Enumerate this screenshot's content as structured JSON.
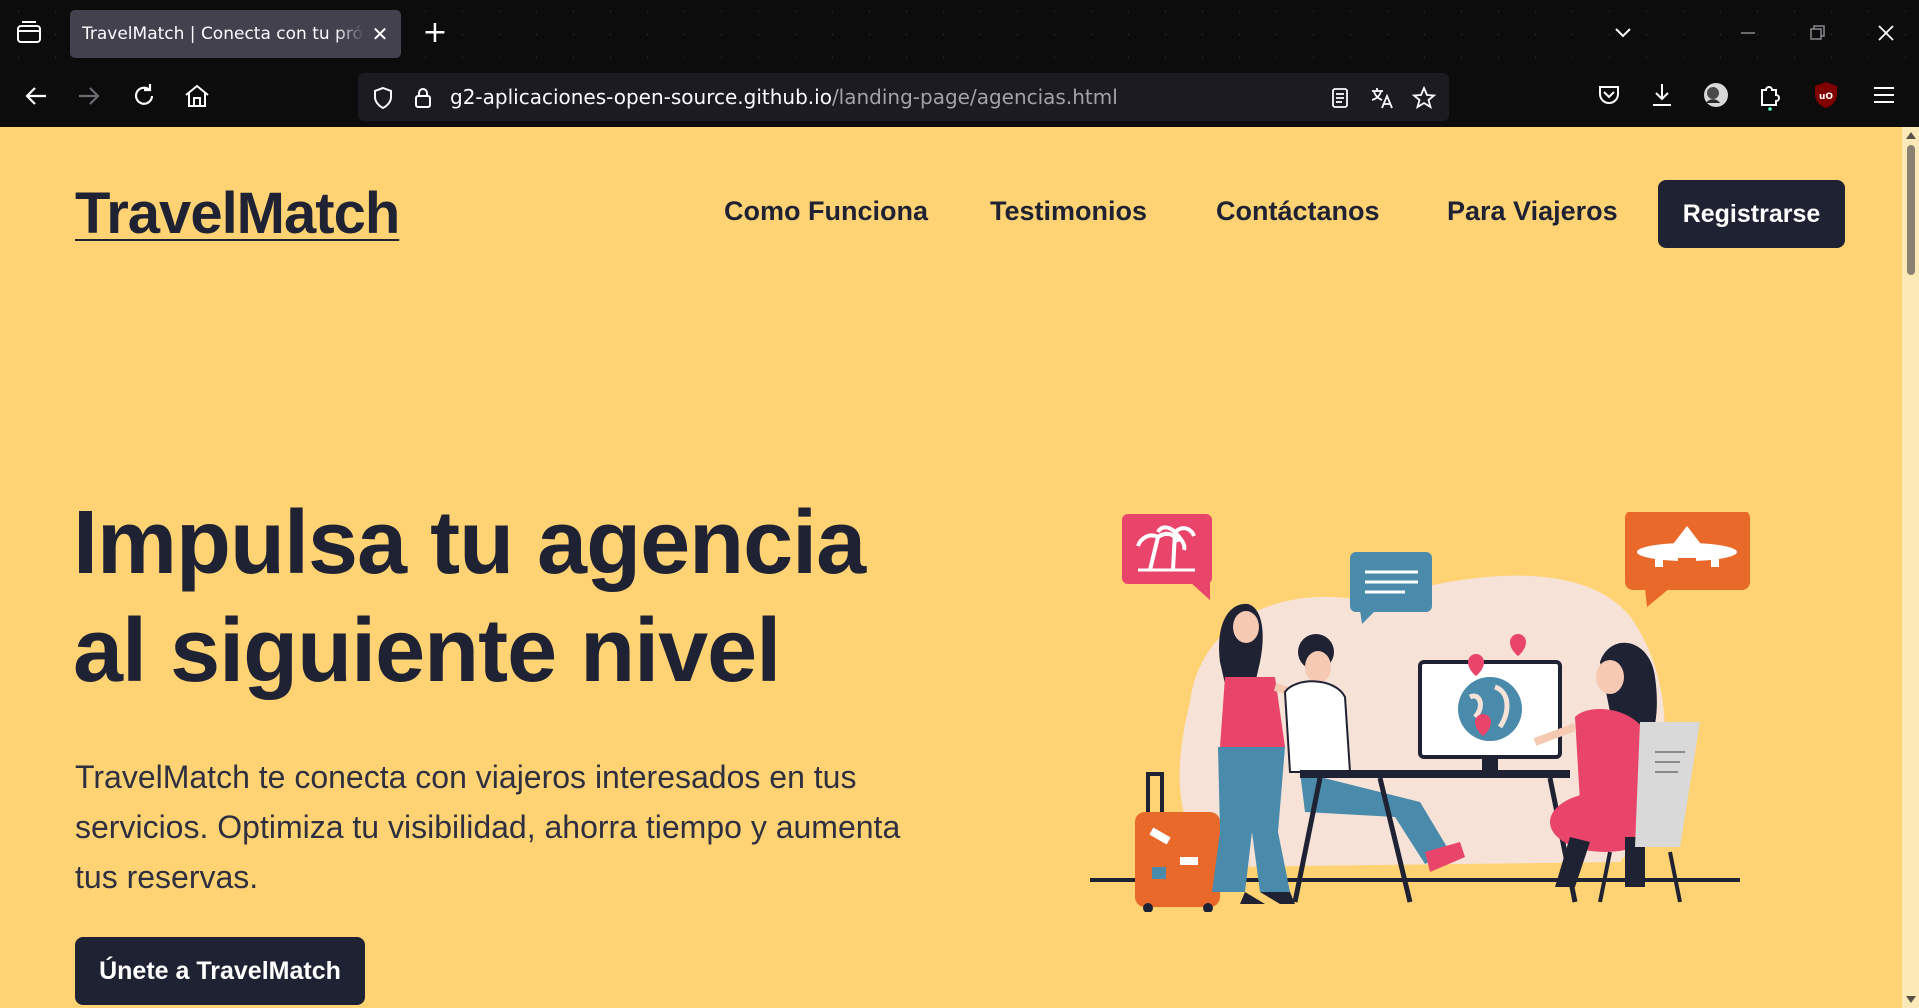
{
  "browser": {
    "tab": {
      "title": "TravelMatch | Conecta con tu próximo destino"
    },
    "url": {
      "host": "g2-aplicaciones-open-source.github.io",
      "path": "/landing-page/agencias.html"
    }
  },
  "page": {
    "logo": "TravelMatch",
    "nav": {
      "items": [
        "Como Funciona",
        "Testimonios",
        "Contáctanos",
        "Para Viajeros"
      ],
      "register": "Registrarse"
    },
    "hero": {
      "title_line1": "Impulsa tu agencia",
      "title_line2": "al siguiente nivel",
      "text": "TravelMatch te conecta con viajeros interesados en tus servicios. Optimiza tu visibilidad, ahorra tiempo y aumenta tus reservas.",
      "cta": "Únete a TravelMatch"
    }
  },
  "colors": {
    "page_bg": "#ffd374",
    "primary_dark": "#1f2233",
    "accent_pink": "#e9446a",
    "accent_orange": "#e8692a",
    "accent_teal": "#4a8bab"
  }
}
